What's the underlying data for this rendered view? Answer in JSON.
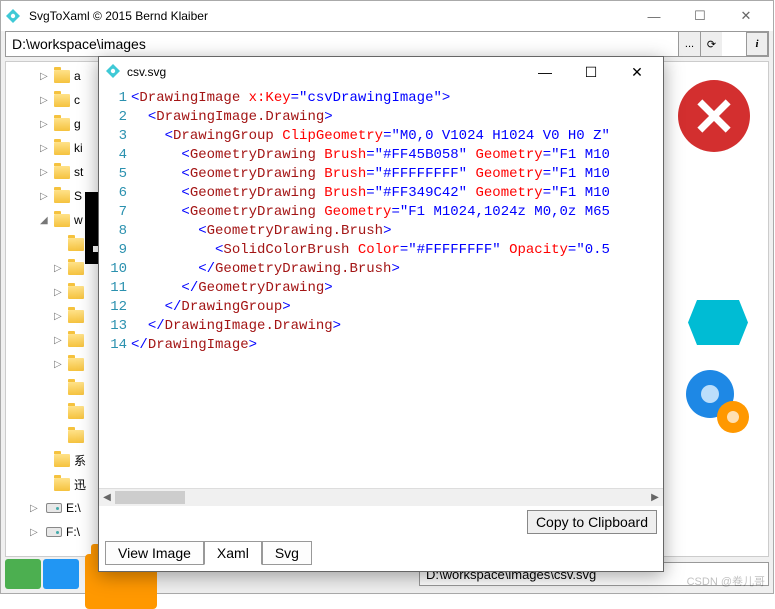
{
  "app": {
    "title": "SvgToXaml   © 2015 Bernd Klaiber",
    "path_input": "D:\\workspace\\images"
  },
  "titlebar_controls": {
    "min": "—",
    "max": "☐",
    "close": "✕"
  },
  "path_buttons": {
    "browse": "...",
    "reload": "⟳",
    "info": "i"
  },
  "tree": {
    "items": [
      {
        "label": "a",
        "expander": "▷",
        "kind": "folder",
        "level": "sub"
      },
      {
        "label": "c",
        "expander": "▷",
        "kind": "folder",
        "level": "sub"
      },
      {
        "label": "g",
        "expander": "▷",
        "kind": "folder",
        "level": "sub"
      },
      {
        "label": "ki",
        "expander": "▷",
        "kind": "folder",
        "level": "sub"
      },
      {
        "label": "st",
        "expander": "▷",
        "kind": "folder",
        "level": "sub"
      },
      {
        "label": "S",
        "expander": "▷",
        "kind": "folder",
        "level": "sub"
      },
      {
        "label": "w",
        "expander": "◢",
        "kind": "folder",
        "level": "sub"
      },
      {
        "label": "",
        "expander": "",
        "kind": "folder",
        "level": "sub2"
      },
      {
        "label": "",
        "expander": "▷",
        "kind": "folder",
        "level": "sub2"
      },
      {
        "label": "",
        "expander": "▷",
        "kind": "folder",
        "level": "sub2"
      },
      {
        "label": "",
        "expander": "▷",
        "kind": "folder",
        "level": "sub2"
      },
      {
        "label": "",
        "expander": "▷",
        "kind": "folder",
        "level": "sub2"
      },
      {
        "label": "",
        "expander": "▷",
        "kind": "folder",
        "level": "sub2"
      },
      {
        "label": "",
        "expander": "",
        "kind": "folder",
        "level": "sub2"
      },
      {
        "label": "",
        "expander": "",
        "kind": "folder",
        "level": "sub2"
      },
      {
        "label": "",
        "expander": "",
        "kind": "folder",
        "level": "sub2"
      },
      {
        "label": "系",
        "expander": "",
        "kind": "folder",
        "level": "sub"
      },
      {
        "label": "迅",
        "expander": "",
        "kind": "folder",
        "level": "sub"
      },
      {
        "label": "E:\\",
        "expander": "▷",
        "kind": "drive",
        "level": "drive"
      },
      {
        "label": "F:\\",
        "expander": "▷",
        "kind": "drive",
        "level": "drive"
      }
    ]
  },
  "status_path": "D:\\workspace\\images\\csv.svg",
  "watermark": "CSDN @卷儿哥",
  "popup": {
    "title": "csv.svg",
    "controls": {
      "min": "—",
      "max": "☐",
      "close": "✕"
    },
    "copy_button": "Copy to Clipboard",
    "tabs": {
      "view": "View Image",
      "xaml": "Xaml",
      "svg": "Svg",
      "active": "xaml"
    },
    "code": {
      "line_count": 14,
      "lines": [
        {
          "indent": 0,
          "raw": "<DrawingImage x:Key=\"csvDrawingImage\">",
          "parts": [
            [
              "punct",
              "<"
            ],
            [
              "elt",
              "DrawingImage "
            ],
            [
              "attr",
              "x:Key"
            ],
            [
              "punct",
              "="
            ],
            [
              "val",
              "\"csvDrawingImage\""
            ],
            [
              "punct",
              ">"
            ]
          ]
        },
        {
          "indent": 2,
          "raw": "<DrawingImage.Drawing>",
          "parts": [
            [
              "punct",
              "<"
            ],
            [
              "elt",
              "DrawingImage.Drawing"
            ],
            [
              "punct",
              ">"
            ]
          ]
        },
        {
          "indent": 4,
          "raw": "<DrawingGroup ClipGeometry=\"M0,0 V1024 H1024 V0 H0 Z\">",
          "parts": [
            [
              "punct",
              "<"
            ],
            [
              "elt",
              "DrawingGroup "
            ],
            [
              "attr",
              "ClipGeometry"
            ],
            [
              "punct",
              "="
            ],
            [
              "val",
              "\"M0,0 V1024 H1024 V0 H0 Z\""
            ]
          ]
        },
        {
          "indent": 6,
          "raw": "<GeometryDrawing Brush=\"#FF45B058\" Geometry=\"F1 M10",
          "parts": [
            [
              "punct",
              "<"
            ],
            [
              "elt",
              "GeometryDrawing "
            ],
            [
              "attr",
              "Brush"
            ],
            [
              "punct",
              "="
            ],
            [
              "val",
              "\"#FF45B058\" "
            ],
            [
              "attr",
              "Geometry"
            ],
            [
              "punct",
              "="
            ],
            [
              "val",
              "\"F1 M10"
            ]
          ]
        },
        {
          "indent": 6,
          "raw": "<GeometryDrawing Brush=\"#FFFFFFFF\" Geometry=\"F1 M10",
          "parts": [
            [
              "punct",
              "<"
            ],
            [
              "elt",
              "GeometryDrawing "
            ],
            [
              "attr",
              "Brush"
            ],
            [
              "punct",
              "="
            ],
            [
              "val",
              "\"#FFFFFFFF\" "
            ],
            [
              "attr",
              "Geometry"
            ],
            [
              "punct",
              "="
            ],
            [
              "val",
              "\"F1 M10"
            ]
          ]
        },
        {
          "indent": 6,
          "raw": "<GeometryDrawing Brush=\"#FF349C42\" Geometry=\"F1 M10",
          "parts": [
            [
              "punct",
              "<"
            ],
            [
              "elt",
              "GeometryDrawing "
            ],
            [
              "attr",
              "Brush"
            ],
            [
              "punct",
              "="
            ],
            [
              "val",
              "\"#FF349C42\" "
            ],
            [
              "attr",
              "Geometry"
            ],
            [
              "punct",
              "="
            ],
            [
              "val",
              "\"F1 M10"
            ]
          ]
        },
        {
          "indent": 6,
          "raw": "<GeometryDrawing Geometry=\"F1 M1024,1024z M0,0z M65",
          "parts": [
            [
              "punct",
              "<"
            ],
            [
              "elt",
              "GeometryDrawing "
            ],
            [
              "attr",
              "Geometry"
            ],
            [
              "punct",
              "="
            ],
            [
              "val",
              "\"F1 M1024,1024z M0,0z M65"
            ]
          ]
        },
        {
          "indent": 8,
          "raw": "<GeometryDrawing.Brush>",
          "parts": [
            [
              "punct",
              "<"
            ],
            [
              "elt",
              "GeometryDrawing.Brush"
            ],
            [
              "punct",
              ">"
            ]
          ]
        },
        {
          "indent": 10,
          "raw": "<SolidColorBrush Color=\"#FFFFFFFF\" Opacity=\"0.5",
          "parts": [
            [
              "punct",
              "<"
            ],
            [
              "elt",
              "SolidColorBrush "
            ],
            [
              "attr",
              "Color"
            ],
            [
              "punct",
              "="
            ],
            [
              "val",
              "\"#FFFFFFFF\" "
            ],
            [
              "attr",
              "Opacity"
            ],
            [
              "punct",
              "="
            ],
            [
              "val",
              "\"0.5"
            ]
          ]
        },
        {
          "indent": 8,
          "raw": "</GeometryDrawing.Brush>",
          "parts": [
            [
              "punct",
              "</"
            ],
            [
              "elt",
              "GeometryDrawing.Brush"
            ],
            [
              "punct",
              ">"
            ]
          ]
        },
        {
          "indent": 6,
          "raw": "</GeometryDrawing>",
          "parts": [
            [
              "punct",
              "</"
            ],
            [
              "elt",
              "GeometryDrawing"
            ],
            [
              "punct",
              ">"
            ]
          ]
        },
        {
          "indent": 4,
          "raw": "</DrawingGroup>",
          "parts": [
            [
              "punct",
              "</"
            ],
            [
              "elt",
              "DrawingGroup"
            ],
            [
              "punct",
              ">"
            ]
          ]
        },
        {
          "indent": 2,
          "raw": "</DrawingImage.Drawing>",
          "parts": [
            [
              "punct",
              "</"
            ],
            [
              "elt",
              "DrawingImage.Drawing"
            ],
            [
              "punct",
              ">"
            ]
          ]
        },
        {
          "indent": 0,
          "raw": "</DrawingImage>",
          "parts": [
            [
              "punct",
              "</"
            ],
            [
              "elt",
              "DrawingImage"
            ],
            [
              "punct",
              ">"
            ]
          ]
        }
      ]
    }
  }
}
